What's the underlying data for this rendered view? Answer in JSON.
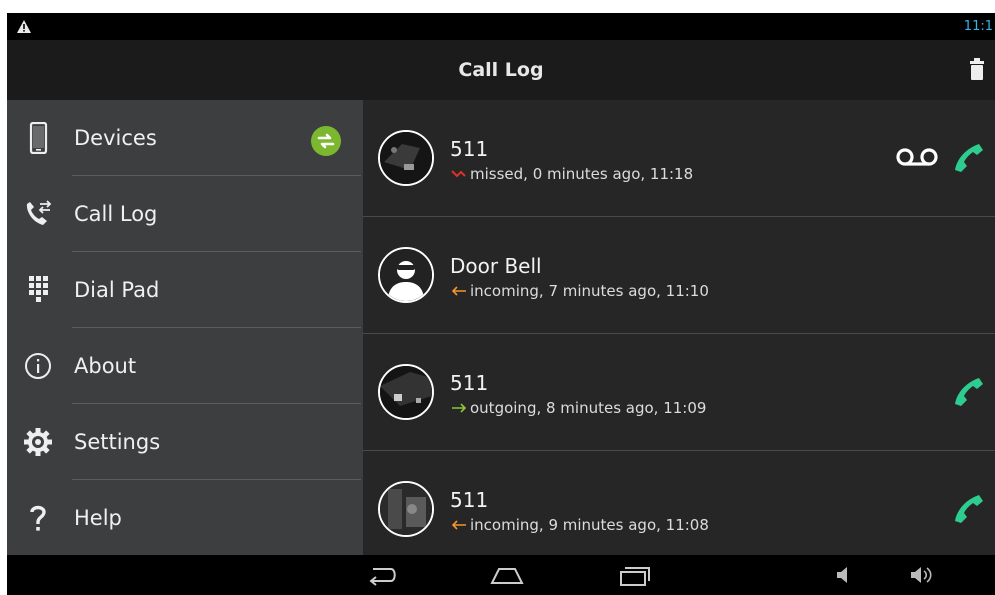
{
  "status_bar": {
    "alert_icon": "warning-icon",
    "time": "11:1"
  },
  "action_bar": {
    "title": "Call Log",
    "trash_icon": "trash-icon"
  },
  "drawer": {
    "items": [
      {
        "label": "Devices",
        "icon": "phone-icon",
        "badge": "sync-icon"
      },
      {
        "label": "Call Log",
        "icon": "call-log-icon"
      },
      {
        "label": "Dial Pad",
        "icon": "dialpad-icon"
      },
      {
        "label": "About",
        "icon": "info-icon"
      },
      {
        "label": "Settings",
        "icon": "gear-icon"
      },
      {
        "label": "Help",
        "icon": "question-icon"
      }
    ]
  },
  "calls": [
    {
      "name": "511",
      "type_icon": "missed-arrow-icon",
      "detail": "missed, 0 minutes ago, 11:18",
      "voicemail": true,
      "callback": true
    },
    {
      "name": "Door Bell",
      "type_icon": "incoming-arrow-icon",
      "detail": "incoming, 7 minutes ago, 11:10",
      "voicemail": false,
      "callback": false
    },
    {
      "name": "511",
      "type_icon": "outgoing-arrow-icon",
      "detail": "outgoing, 8 minutes ago, 11:09",
      "voicemail": false,
      "callback": true
    },
    {
      "name": "511",
      "type_icon": "incoming-arrow-icon",
      "detail": "incoming, 9 minutes ago, 11:08",
      "voicemail": false,
      "callback": true
    }
  ],
  "nav_bar": {
    "back": "back-icon",
    "home": "home-icon",
    "recents": "recents-icon",
    "vol_down": "volume-down-icon",
    "vol_up": "volume-up-icon"
  },
  "colors": {
    "accent_green": "#2ecc8f",
    "missed_red": "#e0302a",
    "incoming_orange": "#f0962a",
    "outgoing_green": "#8cc63f",
    "clock_blue": "#33b5e5"
  }
}
